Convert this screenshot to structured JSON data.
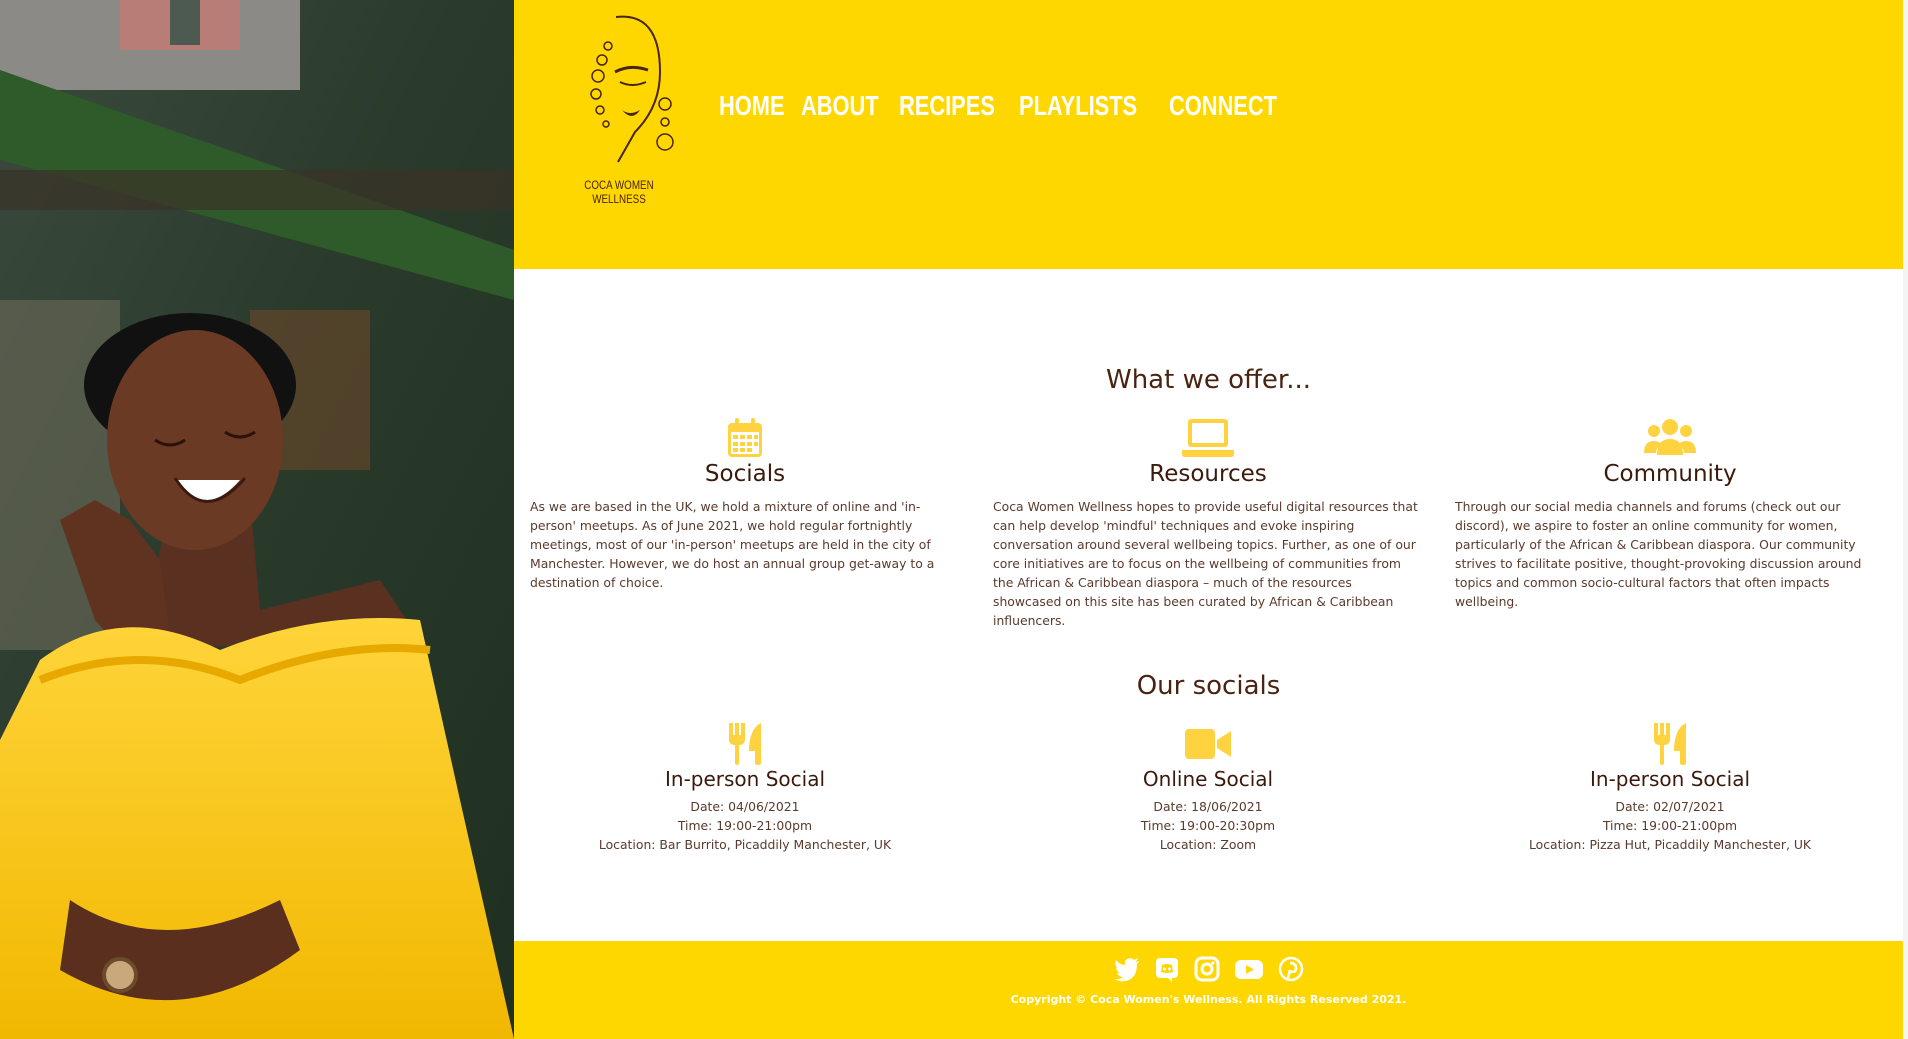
{
  "brand": {
    "logo_text": "COCA WOMEN WELLNESS",
    "accent_color": "#ffd700",
    "text_color": "#4a2313"
  },
  "nav": [
    {
      "label": "HOME"
    },
    {
      "label": "ABOUT"
    },
    {
      "label": "RECIPES"
    },
    {
      "label": "PLAYLISTS"
    },
    {
      "label": "CONNECT"
    }
  ],
  "offer": {
    "title": "What we offer...",
    "items": [
      {
        "icon": "calendar-icon",
        "heading": "Socials",
        "text": "As we are based in the UK, we hold a mixture of online and 'in-person' meetups. As of June 2021, we hold regular fortnightly meetings, most of our 'in-person' meetups are held in the city of Manchester. However, we do host an annual group get-away to a destination of choice."
      },
      {
        "icon": "laptop-icon",
        "heading": "Resources",
        "text": "Coca Women Wellness hopes to provide useful digital resources that can help develop 'mindful' techniques and evoke inspiring conversation around several wellbeing topics. Further, as one of our core initiatives are to focus on the wellbeing of communities from the African & Caribbean diaspora – much of the resources showcased on this site has been curated by African & Caribbean influencers."
      },
      {
        "icon": "users-icon",
        "heading": "Community",
        "text": "Through our social media channels and forums (check out our discord), we aspire to foster an online community for women, particularly of the African & Caribbean diaspora. Our community strives to facilitate positive, thought-provoking discussion around topics and common socio-cultural factors that often impacts wellbeing."
      }
    ]
  },
  "socials": {
    "title": "Our socials",
    "events": [
      {
        "icon": "utensils-icon",
        "heading": "In-person Social",
        "date": "Date: 04/06/2021",
        "time": "Time: 19:00-21:00pm",
        "location": "Location: Bar Burrito, Picaddily Manchester, UK"
      },
      {
        "icon": "video-icon",
        "heading": "Online Social",
        "date": "Date: 18/06/2021",
        "time": "Time: 19:00-20:30pm",
        "location": "Location: Zoom"
      },
      {
        "icon": "utensils-icon",
        "heading": "In-person Social",
        "date": "Date: 02/07/2021",
        "time": "Time: 19:00-21:00pm",
        "location": "Location: Pizza Hut, Picaddily Manchester, UK"
      }
    ]
  },
  "footer": {
    "icons": [
      "twitter-icon",
      "discord-icon",
      "instagram-icon",
      "youtube-icon",
      "pinterest-icon"
    ],
    "copyright": "Copyright © Coca Women's Wellness. All Rights Reserved 2021."
  }
}
